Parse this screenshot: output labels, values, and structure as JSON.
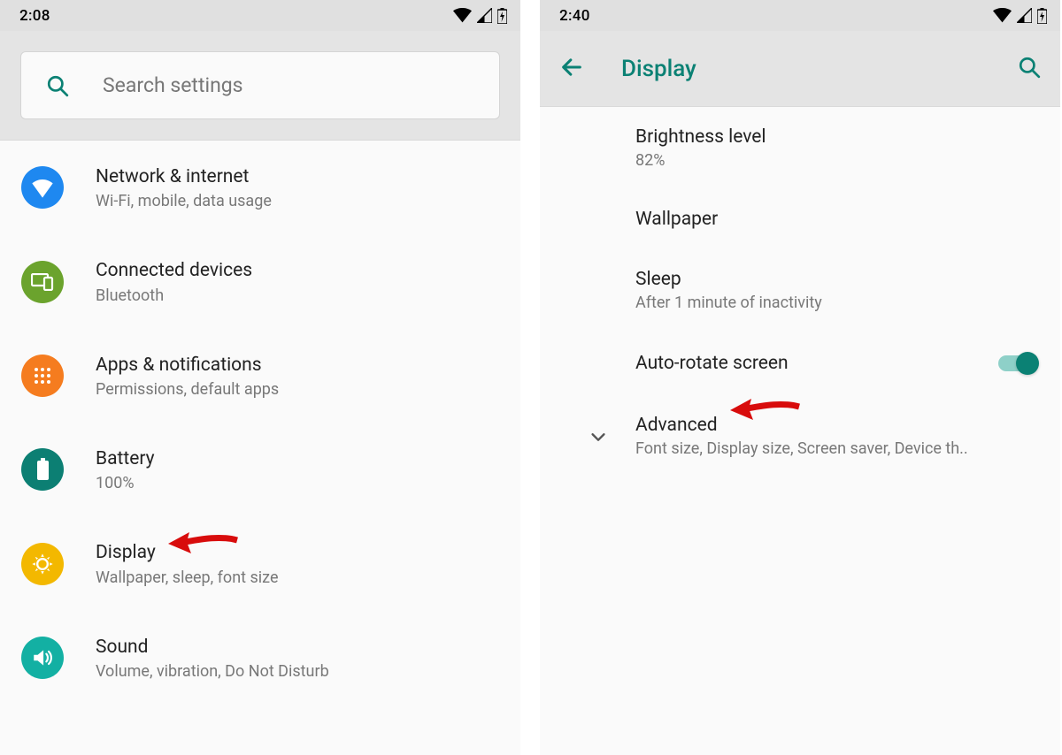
{
  "left": {
    "status_time": "2:08",
    "search_placeholder": "Search settings",
    "items": [
      {
        "title": "Network & internet",
        "sub": "Wi-Fi, mobile, data usage",
        "color": "#1e88f0"
      },
      {
        "title": "Connected devices",
        "sub": "Bluetooth",
        "color": "#6ba32d"
      },
      {
        "title": "Apps & notifications",
        "sub": "Permissions, default apps",
        "color": "#f57c1f"
      },
      {
        "title": "Battery",
        "sub": "100%",
        "color": "#0c7f73"
      },
      {
        "title": "Display",
        "sub": "Wallpaper, sleep, font size",
        "color": "#f3b800"
      },
      {
        "title": "Sound",
        "sub": "Volume, vibration, Do Not Disturb",
        "color": "#13b0a3"
      }
    ]
  },
  "right": {
    "status_time": "2:40",
    "toolbar_title": "Display",
    "items": [
      {
        "title": "Brightness level",
        "sub": "82%"
      },
      {
        "title": "Wallpaper",
        "sub": ""
      },
      {
        "title": "Sleep",
        "sub": "After 1 minute of inactivity"
      },
      {
        "title": "Auto-rotate screen",
        "sub": "",
        "toggle": true
      },
      {
        "title": "Advanced",
        "sub": "Font size, Display size, Screen saver, Device th..",
        "chevron": true
      }
    ]
  },
  "accent": "#0b8174",
  "arrow_color": "#d80c0c"
}
